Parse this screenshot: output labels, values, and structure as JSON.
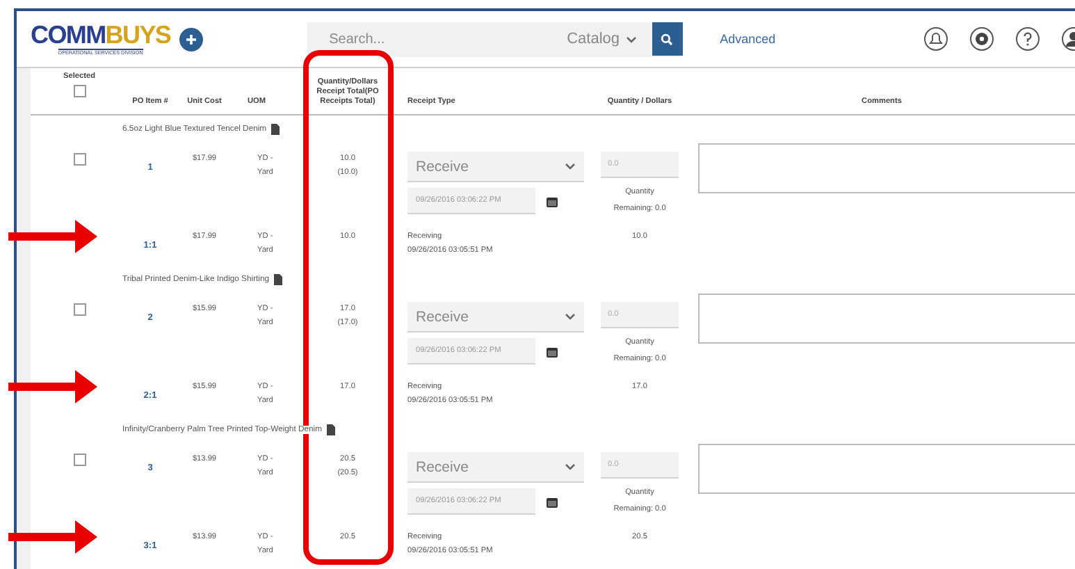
{
  "header": {
    "logo_parts": [
      "COMM",
      "BUYS"
    ],
    "logo_tagline": "OPERATIONAL SERVICES DIVISION",
    "search": {
      "placeholder": "Search...",
      "scope": "Catalog"
    },
    "advanced_link": "Advanced"
  },
  "table": {
    "select_all_checked": false,
    "columns": [
      {
        "label": "Selected",
        "highlighted": false
      },
      {
        "label": "PO Item #",
        "highlighted": false
      },
      {
        "label": "Unit Cost",
        "highlighted": false
      },
      {
        "label": "UOM",
        "highlighted": false
      },
      {
        "label": "Quantity/Dollars Receipt Total(PO Receipts Total)",
        "highlighted": true
      },
      {
        "label": "Receipt Type",
        "highlighted": false
      },
      {
        "label": "Quantity / Dollars",
        "highlighted": false
      },
      {
        "label": "Comments",
        "highlighted": false
      }
    ],
    "groups": [
      {
        "description": "6.5oz Light Blue Textured Tencel Denim",
        "item": {
          "selected": false,
          "po_item": "1",
          "unit_cost": "$17.99",
          "uom": "YD - Yard",
          "quantity": "10.0",
          "quantity_total": "(10.0)",
          "receipt_type": "Receive",
          "receipt_date": "09/26/2016 03:06:22 PM",
          "quantity_input": "0.0",
          "quantity_label": "Quantity",
          "remaining": "Remaining: 0.0"
        },
        "receipt": {
          "highlighted": true,
          "po_item": "1:1",
          "unit_cost": "$17.99",
          "uom": "YD - Yard",
          "quantity": "10.0",
          "receipt_type": "Receiving",
          "receipt_date": "09/26/2016 03:05:51 PM",
          "quantity_dollars": "10.0"
        }
      },
      {
        "description": "Tribal Printed Denim-Like Indigo Shirting",
        "item": {
          "selected": false,
          "po_item": "2",
          "unit_cost": "$15.99",
          "uom": "YD - Yard",
          "quantity": "17.0",
          "quantity_total": "(17.0)",
          "receipt_type": "Receive",
          "receipt_date": "09/26/2016 03:06:22 PM",
          "quantity_input": "0.0",
          "quantity_label": "Quantity",
          "remaining": "Remaining: 0.0"
        },
        "receipt": {
          "highlighted": true,
          "po_item": "2:1",
          "unit_cost": "$15.99",
          "uom": "YD - Yard",
          "quantity": "17.0",
          "receipt_type": "Receiving",
          "receipt_date": "09/26/2016 03:05:51 PM",
          "quantity_dollars": "17.0"
        }
      },
      {
        "description": "Infinity/Cranberry Palm Tree Printed Top-Weight Denim",
        "item": {
          "selected": false,
          "po_item": "3",
          "unit_cost": "$13.99",
          "uom": "YD - Yard",
          "quantity": "20.5",
          "quantity_total": "(20.5)",
          "receipt_type": "Receive",
          "receipt_date": "09/26/2016 03:06:22 PM",
          "quantity_input": "0.0",
          "quantity_label": "Quantity",
          "remaining": "Remaining: 0.0"
        },
        "receipt": {
          "highlighted": true,
          "po_item": "3:1",
          "unit_cost": "$13.99",
          "uom": "YD - Yard",
          "quantity": "20.5",
          "receipt_type": "Receiving",
          "receipt_date": "09/26/2016 03:05:51 PM",
          "quantity_dollars": "20.5"
        }
      }
    ]
  }
}
